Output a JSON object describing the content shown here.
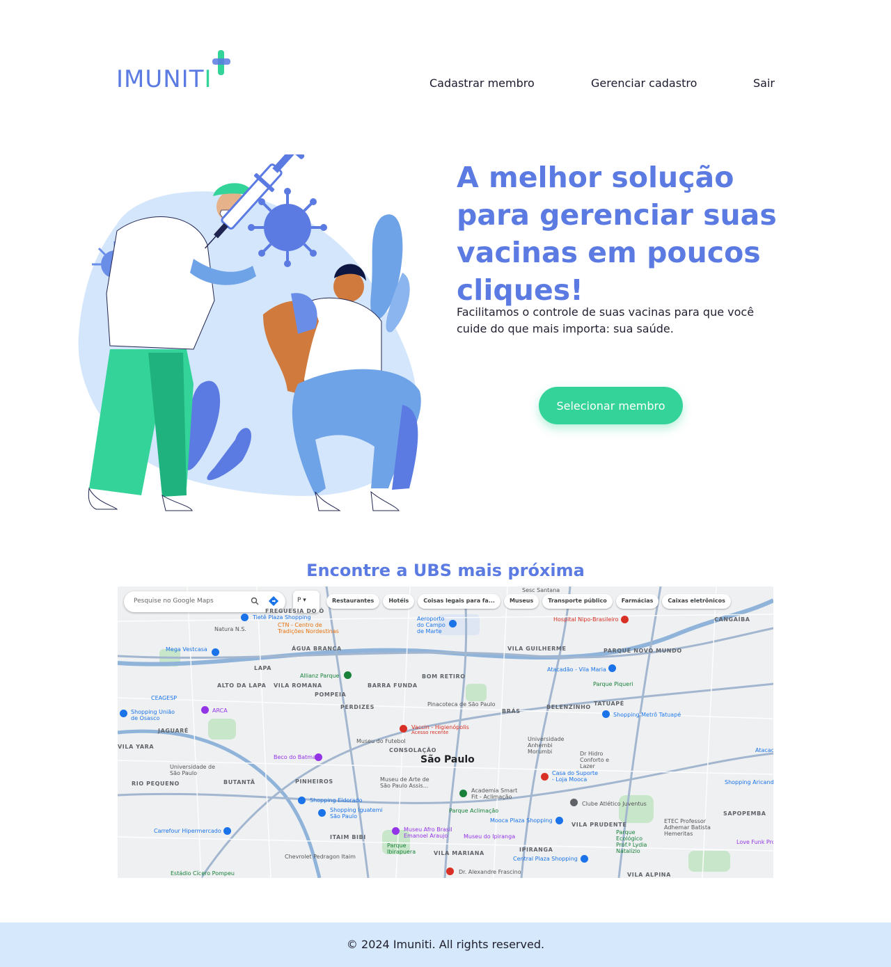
{
  "header": {
    "logo_text_main": "IMUNIT",
    "logo_text_accent": "I",
    "nav": [
      "Cadastrar membro",
      "Gerenciar cadastro",
      "Sair"
    ]
  },
  "hero": {
    "title": "A melhor solução para gerenciar suas vacinas em poucos cliques!",
    "subtitle": "Facilitamos o controle de suas vacinas para que você cuide do que mais importa: sua saúde.",
    "cta_label": "Selecionar membro"
  },
  "map_section": {
    "title": "Encontre a UBS mais próxima",
    "search_placeholder": "Pesquise no Google Maps",
    "layer_label": "P",
    "chips": [
      "Restaurantes",
      "Hotéis",
      "Coisas legais para fa...",
      "Museus",
      "Transporte público",
      "Farmácias",
      "Caixas eletrônicos"
    ],
    "city_label": "São Paulo",
    "districts": [
      "FREGUESIA DO Ó",
      "CANGAÍBA",
      "VILA GUILHERME",
      "PARQUE NOVO MUNDO",
      "ÁGUA BRANCA",
      "LAPA",
      "BOM RETIRO",
      "ALTO DA LAPA",
      "VILA ROMANA",
      "BARRA FUNDA",
      "POMPEIA",
      "PERDIZES",
      "BRÁS",
      "BELENZINHO",
      "TATUAPÉ",
      "JAGUARÉ",
      "CONSOLAÇÃO",
      "VILA YARA",
      "RIO PEQUENO",
      "BUTANTÃ",
      "PINHEIROS",
      "ITAIM BIBI",
      "VILA MARIANA",
      "IPIRANGA",
      "VILA PRUDENTE",
      "VILA ALPINA",
      "SAPOPEMBA"
    ],
    "pois": [
      "Tietê Plaza Shopping",
      "Aeroporto do Campo de Marte",
      "Hospital Nipo-Brasileiro",
      "Natura N.S.",
      "CTN - Centro de Tradições Nordestinas",
      "Mega Vestcasa",
      "Allianz Parque",
      "Atacadão - Vila Maria",
      "Parque Piqueri",
      "Shopping Metrô Tatuapé",
      "Shopping União de Osasco",
      "ARCA",
      "Pinacoteca de São Paulo",
      "Vaccin - Higienópolis",
      "Acesso recente",
      "Museu do Futebol",
      "Universidade Anhembi Morumbi",
      "Dr Hidro Conforto e Lazer",
      "Beco do Batman",
      "Universidade de São Paulo",
      "Casa do Suporte - Loja Mooca",
      "Museu de Arte de São Paulo Assis...",
      "Academia Smart Fit - Aclimação",
      "Shopping Eldorado",
      "Shopping Iguatemi São Paulo",
      "Parque Aclimação",
      "Clube Atlético Juventus",
      "Mooca Plaza Shopping",
      "Carrefour Hipermercado",
      "Museu Afro Brasil Emanoel Araujo",
      "Museu do Ipiranga",
      "Parque Ibirapuera",
      "Chevrolet Pedragon Itaim",
      "Central Plaza Shopping",
      "Dr. Alexandre Frascino",
      "Estádio Cícero Pompeu",
      "ETEC Professor Adhemar Batista Hemeritas",
      "Parque Ecológico Prof.ª Lydia Natalízio",
      "Love Funk Pro",
      "Shopping Aricanduva",
      "Atacadão",
      "Sesc Santana",
      "CEAGESP"
    ]
  },
  "footer": {
    "text": "© 2024 Imuniti. All rights reserved."
  },
  "colors": {
    "brand_blue": "#5b7be3",
    "brand_green": "#34d399",
    "footer_bg": "#d6e8fb"
  }
}
